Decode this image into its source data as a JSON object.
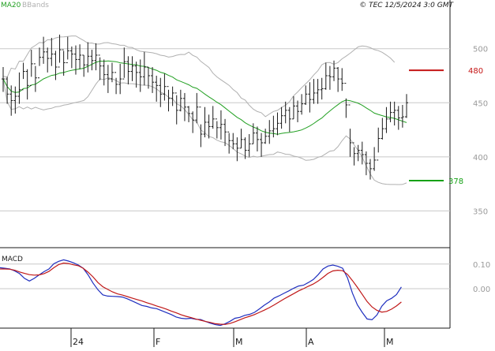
{
  "header": {
    "legend": [
      {
        "label": "MA20",
        "color": "#22a022"
      },
      {
        "label": "BBands",
        "color": "#b0b0b0"
      }
    ],
    "copyright": "© TEC 12/5/2024 3:0 GMT"
  },
  "chart_data": [
    {
      "type": "ohlc",
      "x_axis": {
        "ticks": [
          "24",
          "F",
          "M",
          "A",
          "M"
        ]
      },
      "y_axis": {
        "ticks": [
          {
            "value": 350,
            "label": "350"
          },
          {
            "value": 400,
            "label": "400"
          },
          {
            "value": 450,
            "label": "450"
          },
          {
            "value": 500,
            "label": "500"
          }
        ],
        "range": [
          316,
          545
        ]
      },
      "grid": true,
      "series": [
        {
          "name": "MA20",
          "color": "#22a022"
        },
        {
          "name": "BBands",
          "color": "#b0b0b0"
        }
      ],
      "levels": [
        {
          "value": 480,
          "label": "480",
          "color": "#c41515"
        },
        {
          "value": 378,
          "label": "378",
          "color": "#16a116"
        }
      ],
      "close": [
        472,
        458,
        452,
        456,
        462,
        479,
        466,
        486,
        473,
        492,
        497,
        491,
        495,
        483,
        499,
        487,
        498,
        495,
        490,
        494,
        485,
        493,
        489,
        494,
        484,
        476,
        472,
        478,
        467,
        472,
        488,
        479,
        484,
        478,
        474,
        483,
        475,
        469,
        466,
        458,
        465,
        454,
        459,
        443,
        454,
        446,
        440,
        434,
        446,
        421,
        432,
        428,
        435,
        427,
        430,
        423,
        415,
        412,
        408,
        416,
        406,
        412,
        422,
        416,
        413,
        419,
        424,
        426,
        431,
        438,
        443,
        435,
        447,
        442,
        449,
        458,
        453,
        459,
        462,
        463,
        475,
        474,
        482,
        472,
        468,
        448,
        413,
        403,
        406,
        402,
        394,
        389,
        397,
        417,
        426,
        435,
        441,
        443,
        436,
        437,
        450
      ],
      "high": [
        483,
        474,
        466,
        465,
        478,
        487,
        481,
        499,
        484,
        501,
        511,
        501,
        510,
        498,
        513,
        498,
        511,
        502,
        503,
        504,
        494,
        506,
        499,
        505,
        492,
        490,
        485,
        487,
        473,
        486,
        501,
        493,
        493,
        488,
        490,
        497,
        483,
        483,
        475,
        473,
        477,
        462,
        465,
        457,
        462,
        459,
        447,
        442,
        459,
        430,
        446,
        439,
        447,
        433,
        443,
        435,
        422,
        422,
        418,
        426,
        418,
        421,
        431,
        428,
        422,
        426,
        434,
        438,
        441,
        446,
        451,
        446,
        456,
        452,
        458,
        466,
        469,
        472,
        472,
        473,
        487,
        484,
        489,
        483,
        482,
        454,
        426,
        409,
        411,
        414,
        405,
        398,
        409,
        427,
        436,
        446,
        451,
        451,
        447,
        448,
        458
      ],
      "low": [
        460,
        449,
        438,
        440,
        449,
        472,
        453,
        474,
        460,
        484,
        486,
        478,
        484,
        471,
        487,
        475,
        490,
        482,
        476,
        481,
        474,
        478,
        480,
        480,
        471,
        466,
        459,
        469,
        458,
        458,
        473,
        467,
        470,
        464,
        460,
        466,
        463,
        459,
        451,
        446,
        452,
        442,
        447,
        430,
        442,
        433,
        432,
        422,
        431,
        409,
        418,
        417,
        426,
        417,
        416,
        410,
        403,
        407,
        396,
        408,
        398,
        400,
        412,
        405,
        400,
        412,
        412,
        418,
        420,
        426,
        431,
        423,
        435,
        432,
        439,
        448,
        441,
        449,
        449,
        453,
        462,
        462,
        470,
        460,
        461,
        436,
        400,
        392,
        396,
        393,
        383,
        379,
        387,
        404,
        416,
        422,
        432,
        429,
        425,
        427,
        436
      ]
    },
    {
      "type": "line",
      "title": "MACD",
      "y_axis": {
        "ticks": [
          {
            "value": 10,
            "label": "0.10"
          },
          {
            "value": 0,
            "label": "0.00"
          }
        ],
        "range": [
          -16,
          16
        ]
      },
      "grid": true,
      "series": [
        {
          "name": "MACD",
          "color": "#1f2fbf",
          "values": [
            8.5,
            8.3,
            8.0,
            7.2,
            6.1,
            4.2,
            3.1,
            4.2,
            5.6,
            6.9,
            8.0,
            10.1,
            11.1,
            11.7,
            11.2,
            10.5,
            9.6,
            8.3,
            5.6,
            2.3,
            -0.4,
            -2.5,
            -3.0,
            -3.1,
            -3.2,
            -3.4,
            -4.1,
            -5.0,
            -5.9,
            -6.8,
            -7.2,
            -7.8,
            -8.1,
            -8.9,
            -9.7,
            -10.5,
            -11.5,
            -12.0,
            -12.2,
            -12.0,
            -12.4,
            -12.5,
            -13.3,
            -14.0,
            -14.6,
            -14.9,
            -14.2,
            -13.2,
            -12.0,
            -11.6,
            -10.8,
            -10.4,
            -9.6,
            -8.2,
            -6.7,
            -5.4,
            -3.8,
            -2.9,
            -1.9,
            -0.9,
            0.2,
            1.1,
            1.4,
            2.5,
            3.7,
            5.7,
            8.0,
            9.2,
            9.6,
            9.1,
            8.3,
            4.4,
            -1.8,
            -6.5,
            -9.6,
            -12.3,
            -12.6,
            -10.7,
            -7.1,
            -4.9,
            -3.9,
            -2.4,
            0.7
          ]
        },
        {
          "name": "Signal",
          "color": "#c01818",
          "values": [
            8.0,
            8.0,
            7.9,
            7.5,
            6.8,
            6.2,
            5.7,
            5.5,
            5.6,
            6.1,
            7.0,
            8.5,
            9.8,
            10.4,
            10.2,
            9.7,
            9.3,
            8.3,
            6.7,
            4.8,
            2.5,
            0.8,
            -0.3,
            -1.3,
            -2.1,
            -2.6,
            -3.2,
            -3.8,
            -4.4,
            -5.0,
            -5.7,
            -6.3,
            -7.0,
            -7.6,
            -8.3,
            -9.1,
            -9.8,
            -10.6,
            -11.2,
            -11.7,
            -12.3,
            -12.8,
            -13.3,
            -13.7,
            -14.2,
            -14.4,
            -14.5,
            -14.1,
            -13.4,
            -12.6,
            -11.8,
            -11.2,
            -10.5,
            -9.6,
            -8.7,
            -7.7,
            -6.6,
            -5.4,
            -4.2,
            -3.1,
            -2.0,
            -0.9,
            0.0,
            1.0,
            1.9,
            3.1,
            4.6,
            6.2,
            7.2,
            7.5,
            7.3,
            5.8,
            3.3,
            0.6,
            -2.3,
            -5.2,
            -7.4,
            -8.8,
            -9.5,
            -9.2,
            -8.3,
            -7.0,
            -5.4
          ]
        }
      ]
    }
  ]
}
